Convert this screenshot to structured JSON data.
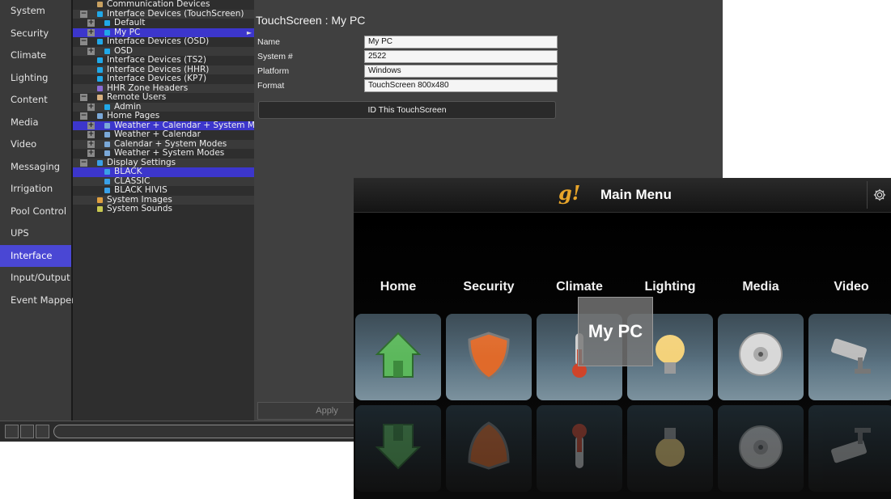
{
  "nav": {
    "items": [
      "System",
      "Security",
      "Climate",
      "Lighting",
      "Content",
      "Media",
      "Video",
      "Messaging",
      "Irrigation",
      "Pool Control",
      "UPS",
      "Interface",
      "Input/Output",
      "Event Mapper"
    ],
    "active_index": 11
  },
  "tree": {
    "rows": [
      {
        "label": "Communication Devices",
        "indent": 0,
        "expander": "",
        "icon": "network-icon"
      },
      {
        "label": "Interface Devices (TouchScreen)",
        "indent": 0,
        "expander": "−",
        "icon": "screen-icon"
      },
      {
        "label": "Default",
        "indent": 1,
        "expander": "+",
        "icon": "screen-icon"
      },
      {
        "label": "My PC",
        "indent": 1,
        "expander": "+",
        "icon": "screen-icon",
        "selected": true,
        "arrow": "►"
      },
      {
        "label": "Interface Devices (OSD)",
        "indent": 0,
        "expander": "−",
        "icon": "screen-icon"
      },
      {
        "label": "OSD",
        "indent": 1,
        "expander": "+",
        "icon": "screen-icon"
      },
      {
        "label": "Interface Devices (TS2)",
        "indent": 0,
        "expander": "",
        "icon": "screen-icon"
      },
      {
        "label": "Interface Devices (HHR)",
        "indent": 0,
        "expander": "",
        "icon": "screen-icon"
      },
      {
        "label": "Interface Devices (KP7)",
        "indent": 0,
        "expander": "",
        "icon": "screen-icon"
      },
      {
        "label": "HHR Zone Headers",
        "indent": 0,
        "expander": "",
        "icon": "remote-icon"
      },
      {
        "label": "Remote Users",
        "indent": 0,
        "expander": "−",
        "icon": "user-icon"
      },
      {
        "label": "Admin",
        "indent": 1,
        "expander": "+",
        "icon": "screen-icon"
      },
      {
        "label": "Home Pages",
        "indent": 0,
        "expander": "−",
        "icon": "page-icon"
      },
      {
        "label": "Weather + Calendar + System Modes",
        "indent": 1,
        "expander": "+",
        "icon": "page-icon",
        "selected": true
      },
      {
        "label": "Weather + Calendar",
        "indent": 1,
        "expander": "+",
        "icon": "page-icon"
      },
      {
        "label": "Calendar + System Modes",
        "indent": 1,
        "expander": "+",
        "icon": "page-icon"
      },
      {
        "label": "Weather + System Modes",
        "indent": 1,
        "expander": "+",
        "icon": "page-icon"
      },
      {
        "label": "Display Settings",
        "indent": 0,
        "expander": "−",
        "icon": "display-icon"
      },
      {
        "label": "BLACK",
        "indent": 1,
        "expander": "",
        "icon": "display-icon",
        "selected": true
      },
      {
        "label": "CLASSIC",
        "indent": 1,
        "expander": "",
        "icon": "display-icon"
      },
      {
        "label": "BLACK HIVIS",
        "indent": 1,
        "expander": "",
        "icon": "display-icon"
      },
      {
        "label": "System Images",
        "indent": 0,
        "expander": "",
        "icon": "image-icon"
      },
      {
        "label": "System Sounds",
        "indent": 0,
        "expander": "",
        "icon": "sound-icon"
      }
    ]
  },
  "detail": {
    "title": "TouchScreen : My PC",
    "fields": [
      {
        "label": "Name",
        "value": "My PC"
      },
      {
        "label": "System #",
        "value": "2522"
      },
      {
        "label": "Platform",
        "value": "Windows"
      },
      {
        "label": "Format",
        "value": "TouchScreen 800x480"
      }
    ],
    "id_button": "ID This TouchScreen",
    "apply_button": "Apply"
  },
  "touchscreen": {
    "logo": "g!",
    "title": "Main Menu",
    "settings_icon": "gear-icon",
    "tooltip": "My PC",
    "menu": [
      {
        "label": "Home",
        "icon": "house-icon"
      },
      {
        "label": "Security",
        "icon": "shield-icon"
      },
      {
        "label": "Climate",
        "icon": "thermometer-icon"
      },
      {
        "label": "Lighting",
        "icon": "lightbulb-icon"
      },
      {
        "label": "Media",
        "icon": "disc-icon"
      },
      {
        "label": "Video",
        "icon": "camera-icon"
      }
    ]
  },
  "colors": {
    "nav_active": "#4a47d4",
    "tree_selected": "#3c36cc",
    "logo": "#e8a52a",
    "tile": "#5d7584"
  }
}
